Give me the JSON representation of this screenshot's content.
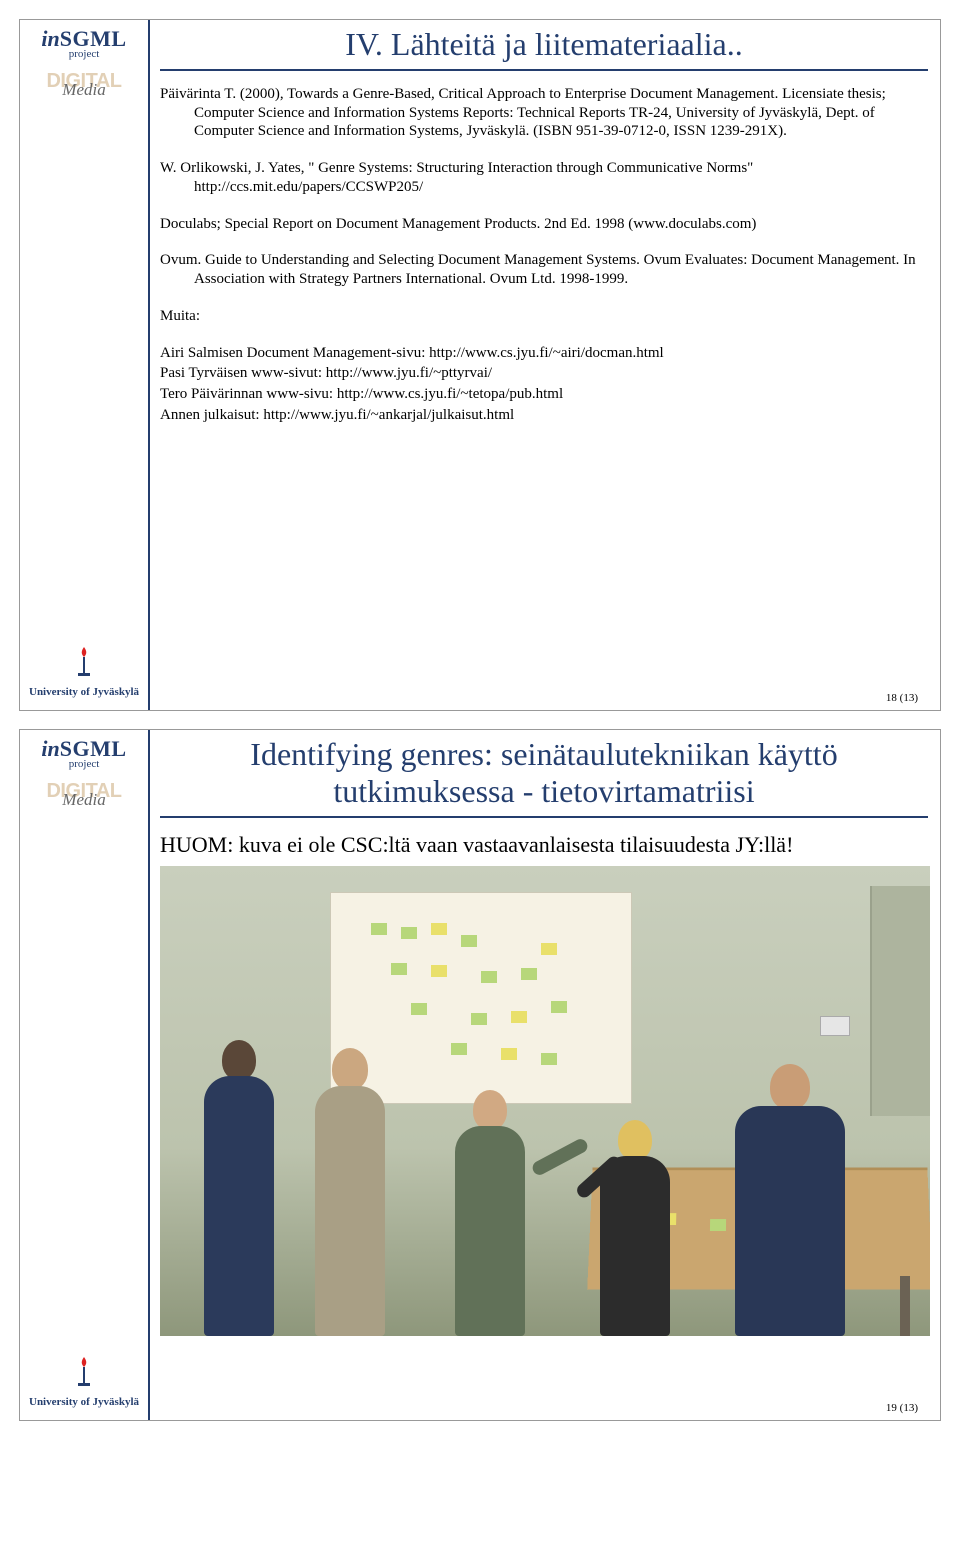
{
  "global": {
    "logo_in": "in",
    "logo_sgml": "SGML",
    "logo_sub": "project",
    "digital": "DIGITAL",
    "media": "Media",
    "university": "University of Jyväskylä"
  },
  "slide1": {
    "title": "IV. Lähteitä ja liitemateriaalia..",
    "refs": [
      "Päivärinta T. (2000), Towards a Genre-Based, Critical Approach to Enterprise Document Management. Licensiate thesis; Computer Science and Information Systems Reports: Technical Reports TR-24, University of Jyväskylä, Dept. of Computer Science and Information Systems, Jyväskylä. (ISBN 951-39-0712-0, ISSN 1239-291X).",
      "W. Orlikowski, J. Yates, \" Genre Systems: Structuring Interaction through Communicative Norms\" http://ccs.mit.edu/papers/CCSWP205/",
      "Doculabs; Special Report on Document Management Products. 2nd Ed. 1998 (www.doculabs.com)",
      "Ovum. Guide to Understanding and Selecting Document Management Systems. Ovum Evaluates: Document Management. In Association with Strategy Partners International. Ovum Ltd. 1998-1999."
    ],
    "muita_label": "Muita:",
    "links": [
      "Airi Salmisen Document Management-sivu: http://www.cs.jyu.fi/~airi/docman.html",
      "Pasi Tyrväisen www-sivut: http://www.jyu.fi/~pttyrvai/",
      "Tero Päivärinnan www-sivu: http://www.cs.jyu.fi/~tetopa/pub.html",
      "Annen julkaisut: http://www.jyu.fi/~ankarjal/julkaisut.html"
    ],
    "pagenum": "18 (13)"
  },
  "slide2": {
    "title": "Identifying genres: seinätaulutekniikan käyttö tutkimuksessa - tietovirtamatriisi",
    "note": "HUOM: kuva ei ole CSC:ltä vaan vastaavanlaisesta tilaisuudesta JY:llä!",
    "pagenum": "19 (13)"
  }
}
